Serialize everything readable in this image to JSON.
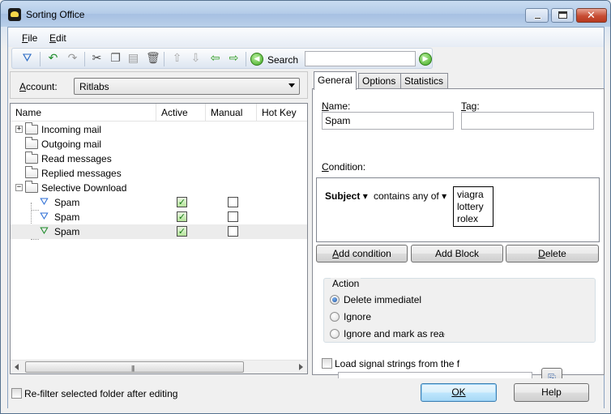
{
  "window": {
    "title": "Sorting Office"
  },
  "menu": {
    "file": "File",
    "edit": "Edit"
  },
  "toolbar": {
    "search_label": "Search",
    "search_value": "",
    "icons": [
      "new-filter-icon",
      "undo-icon",
      "redo-icon",
      "cut-icon",
      "copy-icon",
      "paste-icon",
      "delete-icon",
      "move-up-icon",
      "move-down-icon",
      "move-left-icon",
      "move-right-icon",
      "search-back-icon",
      "search-go-icon"
    ]
  },
  "account": {
    "label": "Account:",
    "value": "Ritlabs"
  },
  "tree": {
    "columns": [
      "Name",
      "Active",
      "Manual",
      "Hot Key"
    ],
    "rows": [
      {
        "label": "Incoming mail",
        "type": "folder",
        "expander": "+"
      },
      {
        "label": "Outgoing mail",
        "type": "folder"
      },
      {
        "label": "Read messages",
        "type": "folder"
      },
      {
        "label": "Replied messages",
        "type": "folder"
      },
      {
        "label": "Selective Download",
        "type": "folder",
        "expander": "−"
      },
      {
        "label": "Spam",
        "type": "filter",
        "active": true,
        "manual": false
      },
      {
        "label": "Spam",
        "type": "filter",
        "active": true,
        "manual": false
      },
      {
        "label": "Spam",
        "type": "filter",
        "active": true,
        "manual": false,
        "selected": true
      }
    ]
  },
  "tabs": [
    "General",
    "Options",
    "Statistics"
  ],
  "general": {
    "name_label": "Name:",
    "name_value": "Spam",
    "tag_label": "Tag:",
    "tag_value": "",
    "condition_label": "Condition:",
    "condition": {
      "field": "Subject",
      "operator": "contains any of",
      "values": [
        "viagra",
        "lottery",
        "rolex"
      ]
    },
    "buttons": {
      "add_condition": "Add condition",
      "add_block": "Add Block",
      "delete": "Delete"
    },
    "action": {
      "title": "Action",
      "options": [
        "Delete immediatel",
        "Ignore",
        "Ignore and mark as reac"
      ],
      "selected_index": 0
    },
    "load_signal_label": "Load signal strings from the f",
    "load_signal_checked": false,
    "load_signal_path": ""
  },
  "footer": {
    "refilter_label": "Re-filter selected folder after editing",
    "refilter_checked": false,
    "ok": "OK",
    "help": "Help"
  }
}
